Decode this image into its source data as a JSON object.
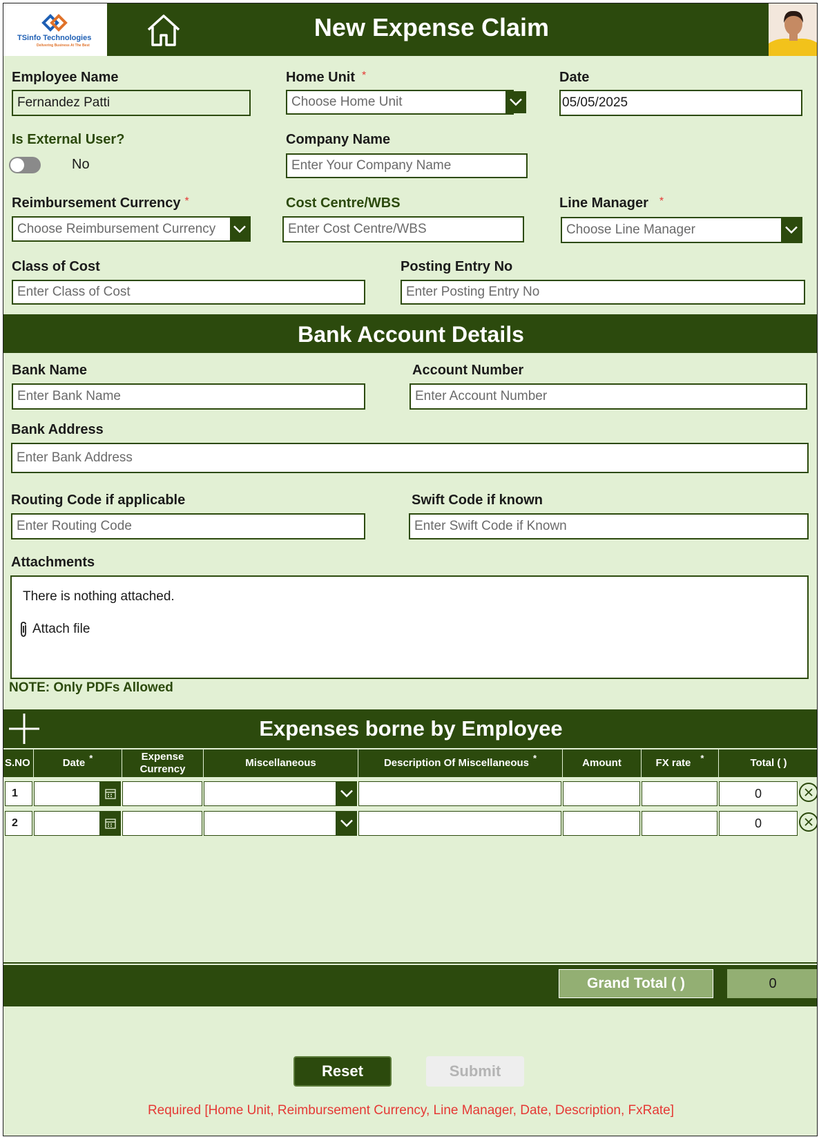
{
  "header": {
    "title": "New Expense Claim",
    "logo_name": "TSinfo Technologies",
    "logo_tagline": "Delivering Business At The Best"
  },
  "form": {
    "employee_name": {
      "label": "Employee Name",
      "value": "Fernandez Patti"
    },
    "home_unit": {
      "label": "Home Unit",
      "required_mark": "*",
      "placeholder": "Choose Home Unit"
    },
    "date": {
      "label": "Date",
      "value": "05/05/2025"
    },
    "external_user": {
      "label": "Is External User?",
      "state": "No"
    },
    "company_name": {
      "label": "Company Name",
      "placeholder": "Enter Your Company Name"
    },
    "reimbursement_currency": {
      "label": "Reimbursement Currency",
      "required_mark": "*",
      "placeholder": "Choose Reimbursement Currency"
    },
    "cost_centre": {
      "label": "Cost Centre/WBS",
      "placeholder": "Enter Cost Centre/WBS"
    },
    "line_manager": {
      "label": "Line Manager",
      "required_mark": "*",
      "placeholder": "Choose Line Manager"
    },
    "class_of_cost": {
      "label": "Class of Cost",
      "placeholder": "Enter Class of Cost"
    },
    "posting_entry": {
      "label": "Posting Entry No",
      "placeholder": "Enter Posting Entry No"
    }
  },
  "bank": {
    "title": "Bank Account Details",
    "bank_name": {
      "label": "Bank Name",
      "placeholder": "Enter Bank Name"
    },
    "account_number": {
      "label": "Account Number",
      "placeholder": "Enter Account Number"
    },
    "bank_address": {
      "label": "Bank Address",
      "placeholder": "Enter Bank Address"
    },
    "routing_code": {
      "label": "Routing Code if applicable",
      "placeholder": "Enter Routing Code"
    },
    "swift_code": {
      "label": "Swift Code if known",
      "placeholder": "Enter Swift Code if Known"
    }
  },
  "attachments": {
    "label": "Attachments",
    "empty_text": "There is nothing attached.",
    "attach_label": "Attach file",
    "note": "NOTE: Only PDFs Allowed"
  },
  "expenses": {
    "title": "Expenses borne by Employee",
    "columns": {
      "sno": "S.NO",
      "date": "Date",
      "date_star": "*",
      "expense_currency": "Expense Currency",
      "misc": "Miscellaneous",
      "description": "Description Of Miscellaneous",
      "description_star": "*",
      "amount": "Amount",
      "fx_rate": "FX rate",
      "fx_star": "*",
      "total": "Total ( )"
    },
    "rows": [
      {
        "sno": "1",
        "total": "0"
      },
      {
        "sno": "2",
        "total": "0"
      }
    ],
    "grand_total_label": "Grand Total ( )",
    "grand_total_value": "0"
  },
  "actions": {
    "reset": "Reset",
    "submit": "Submit",
    "required_note": "Required [Home Unit, Reimbursement Currency, Line Manager, Date, Description, FxRate]"
  },
  "colors": {
    "primary": "#2c4a0d",
    "background": "#e2f0d4",
    "accent_light": "#93af73",
    "required": "#e53935"
  }
}
